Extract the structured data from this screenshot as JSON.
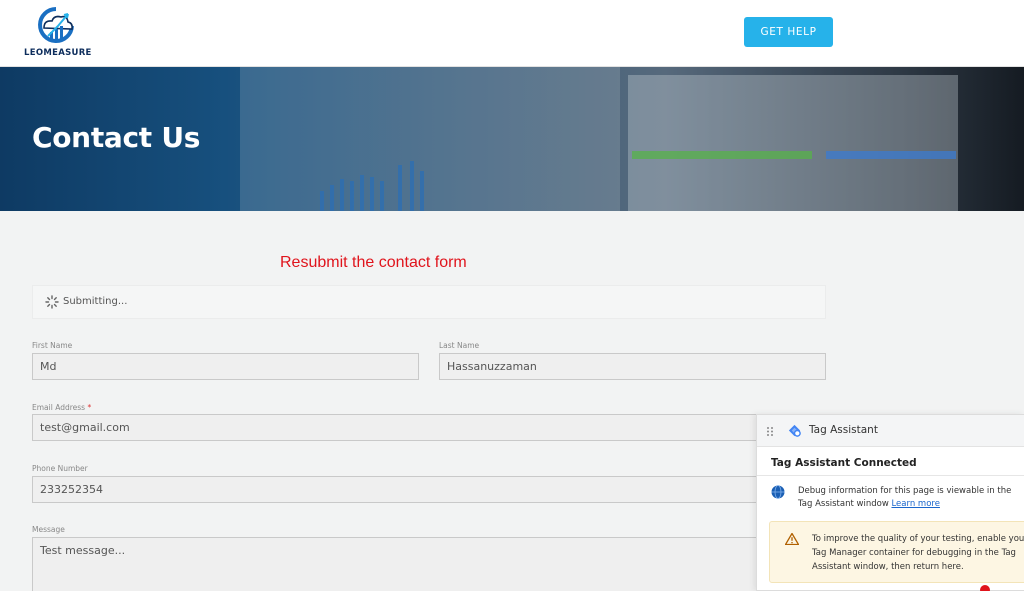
{
  "header": {
    "logo_text": "LEOMEASURE",
    "get_help_label": "GET HELP"
  },
  "hero": {
    "title": "Contact Us"
  },
  "annotation": {
    "text": "Resubmit the contact form"
  },
  "status": {
    "submitting_text": "Submitting..."
  },
  "form": {
    "first_name": {
      "label": "First Name",
      "value": "Md"
    },
    "last_name": {
      "label": "Last Name",
      "value": "Hassanuzzaman"
    },
    "email": {
      "label": "Email Address",
      "required_mark": "*",
      "value": "test@gmail.com"
    },
    "phone": {
      "label": "Phone Number",
      "value": "233252354"
    },
    "message": {
      "label": "Message",
      "value": "Test message..."
    }
  },
  "tag_assistant": {
    "title": "Tag Assistant",
    "connected_title": "Tag Assistant Connected",
    "debug_text": "Debug information for this page is viewable in the Tag Assistant window",
    "learn_more": "Learn more",
    "warning_text": "To improve the quality of your testing, enable your Tag Manager container for debugging in the Tag Assistant window, then return here."
  },
  "colors": {
    "accent": "#26b2ea",
    "annotation_red": "#e0141c",
    "warning_bg": "#fdf6e3"
  },
  "icons": [
    "logo-icon",
    "spinner-icon",
    "drag-handle-icon",
    "tag-assistant-icon",
    "globe-icon",
    "warning-icon"
  ]
}
